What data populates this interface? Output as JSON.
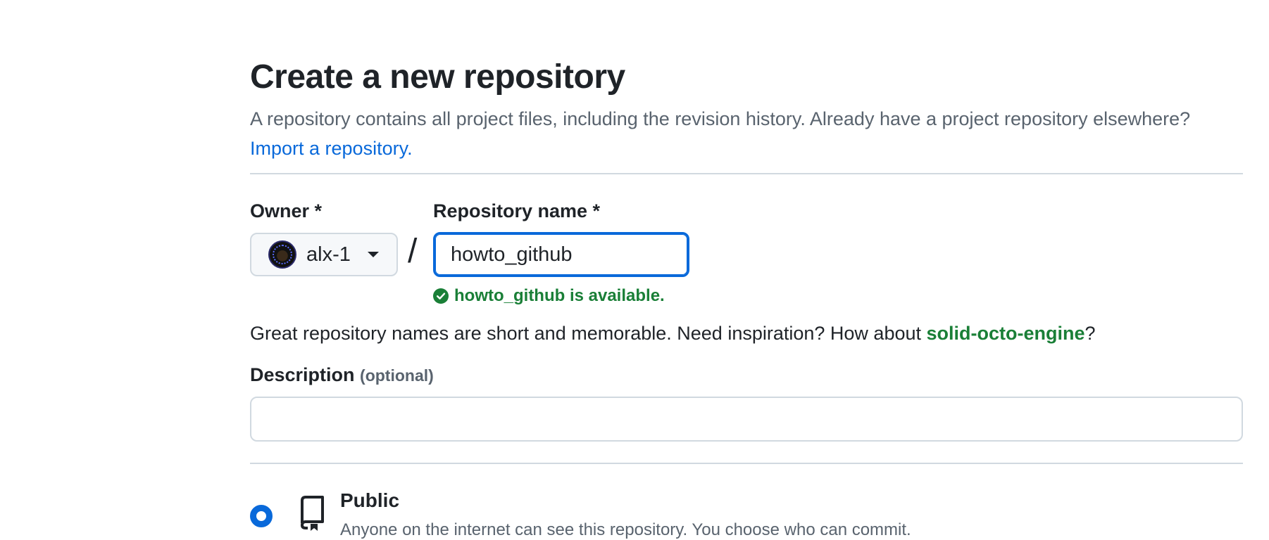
{
  "page": {
    "title": "Create a new repository",
    "subtitle": "A repository contains all project files, including the revision history. Already have a project repository elsewhere?",
    "import_link": "Import a repository."
  },
  "owner": {
    "label": "Owner *",
    "value": "alx-1",
    "icon": "caret-down-icon"
  },
  "separator": "/",
  "repository": {
    "label": "Repository name *",
    "value": "howto_github",
    "availability": "howto_github is available.",
    "availability_icon": "check-circle-icon",
    "hint_prefix": "Great repository names are short and memorable. Need inspiration? How about",
    "suggestion": "solid-octo-engine",
    "hint_suffix": "?"
  },
  "description": {
    "label": "Description",
    "optional": "(optional)",
    "value": ""
  },
  "visibility": {
    "selected": "public",
    "public": {
      "title": "Public",
      "description": "Anyone on the internet can see this repository. You choose who can commit.",
      "icon": "repo-icon"
    }
  },
  "colors": {
    "accent": "#0969da",
    "success": "#1a7f37",
    "muted": "#59636e",
    "border": "#d1d9e0",
    "text": "#1f2328"
  }
}
